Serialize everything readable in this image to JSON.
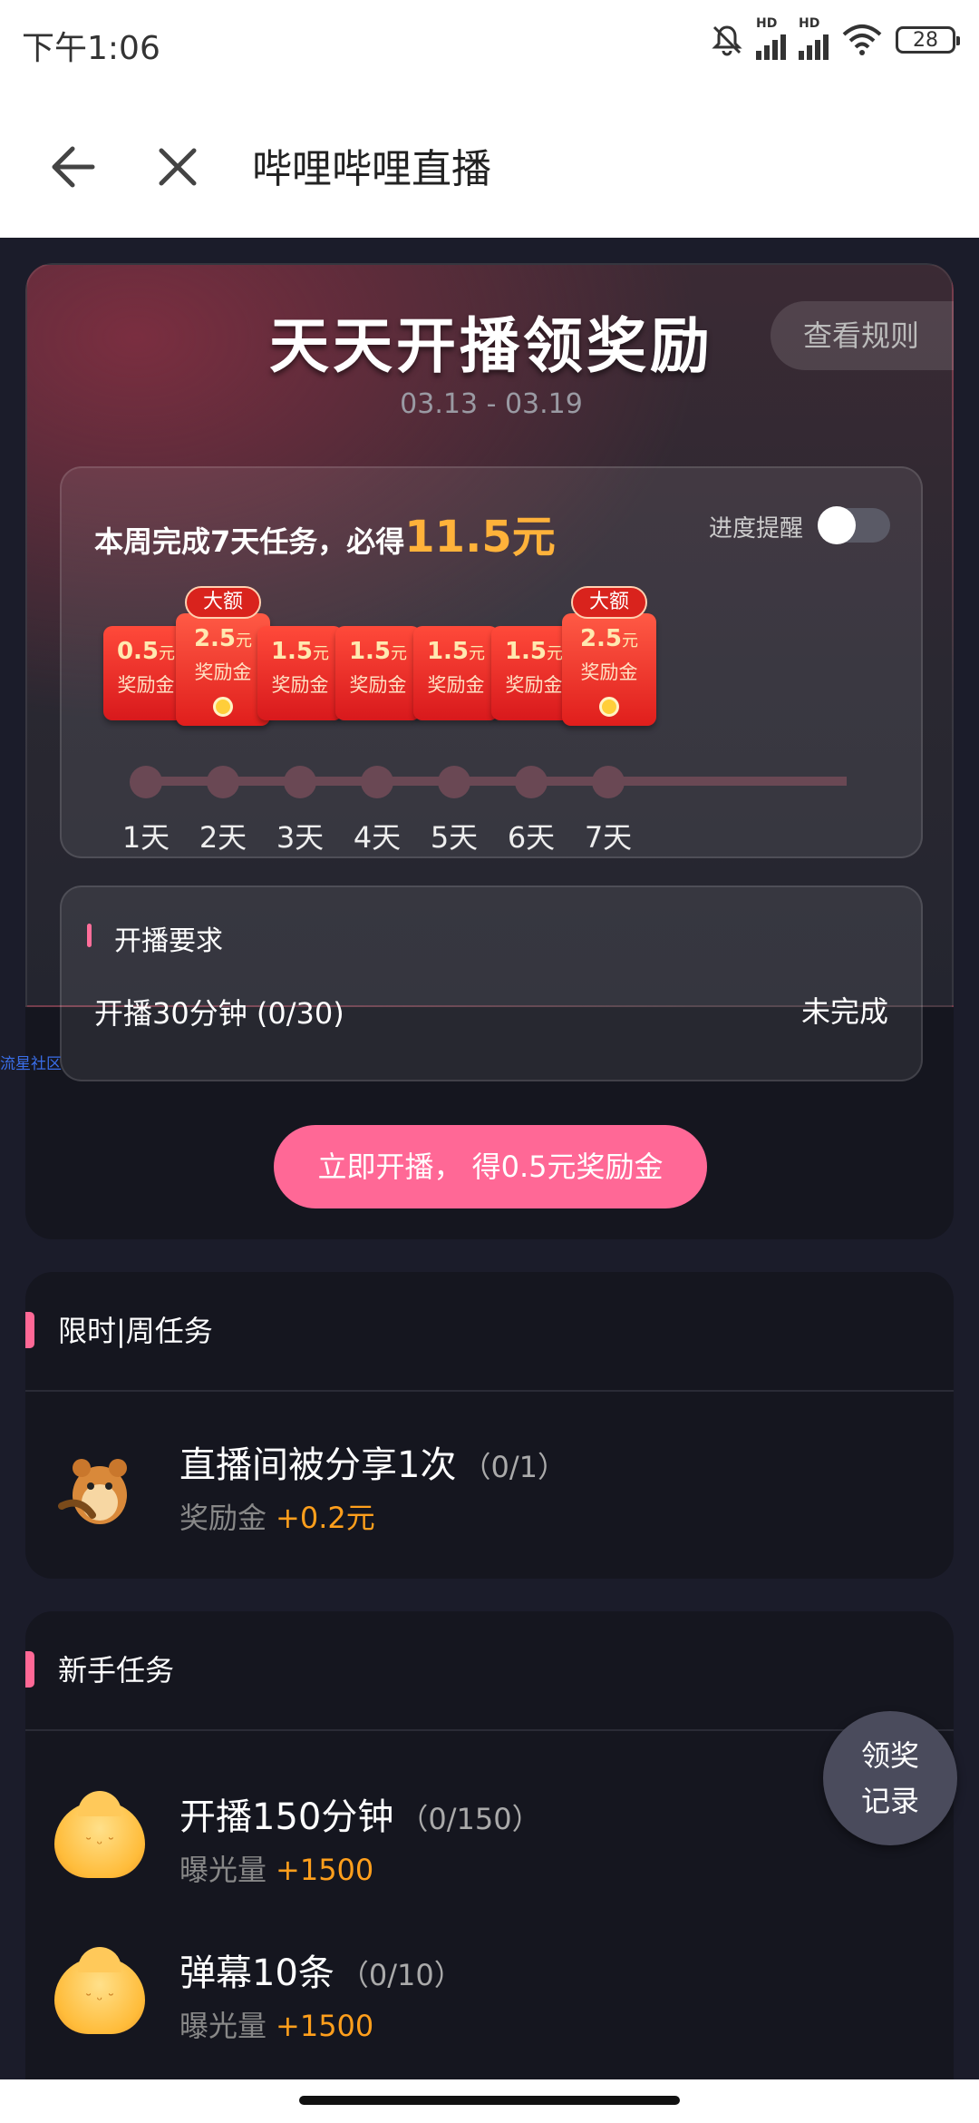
{
  "status_bar": {
    "time": "下午1:06",
    "signal1_label": "HD",
    "signal2_label": "HD",
    "battery": "28"
  },
  "nav": {
    "title": "哔哩哔哩直播"
  },
  "hero": {
    "title": "天天开播领奖励",
    "rules_button": "查看规则",
    "date_range": "03.13 - 03.19",
    "headline": "本周完成7天任务，必得",
    "headline_amount": "11.5元",
    "reminder_label": "进度提醒",
    "reminder_on": false,
    "days": [
      {
        "amount": "0.5",
        "unit": "元",
        "label": "奖励金",
        "big": false,
        "day": "1天"
      },
      {
        "amount": "2.5",
        "unit": "元",
        "label": "奖励金",
        "big": true,
        "badge": "大额",
        "day": "2天"
      },
      {
        "amount": "1.5",
        "unit": "元",
        "label": "奖励金",
        "big": false,
        "day": "3天"
      },
      {
        "amount": "1.5",
        "unit": "元",
        "label": "奖励金",
        "big": false,
        "day": "4天"
      },
      {
        "amount": "1.5",
        "unit": "元",
        "label": "奖励金",
        "big": false,
        "day": "5天"
      },
      {
        "amount": "1.5",
        "unit": "元",
        "label": "奖励金",
        "big": false,
        "day": "6天"
      },
      {
        "amount": "2.5",
        "unit": "元",
        "label": "奖励金",
        "big": true,
        "badge": "大额",
        "day": "7天"
      }
    ],
    "requirement": {
      "title": "开播要求",
      "task": "开播30分钟 (0/30)",
      "status": "未完成"
    },
    "cta": "立即开播， 得0.5元奖励金"
  },
  "side_link": "流星社区",
  "weekly": {
    "title": "限时|周任务",
    "tasks": [
      {
        "name": "直播间被分享1次",
        "progress": "（0/1）",
        "reward_label": "奖励金",
        "reward_value": "+0.2元"
      }
    ]
  },
  "newbie": {
    "title": "新手任务",
    "tasks": [
      {
        "name": "开播150分钟",
        "progress": "（0/150）",
        "reward_label": "曝光量",
        "reward_value": "+1500"
      },
      {
        "name": "弹幕10条",
        "progress": "（0/10）",
        "reward_label": "曝光量",
        "reward_value": "+1500"
      }
    ]
  },
  "float_button": {
    "line1": "领奖",
    "line2": "记录"
  },
  "colors": {
    "accent_pink": "#ff6896",
    "reward_orange": "#ff9f1c",
    "amount_gold": "#ffb23a",
    "envelope_red": "#e01e1c"
  }
}
